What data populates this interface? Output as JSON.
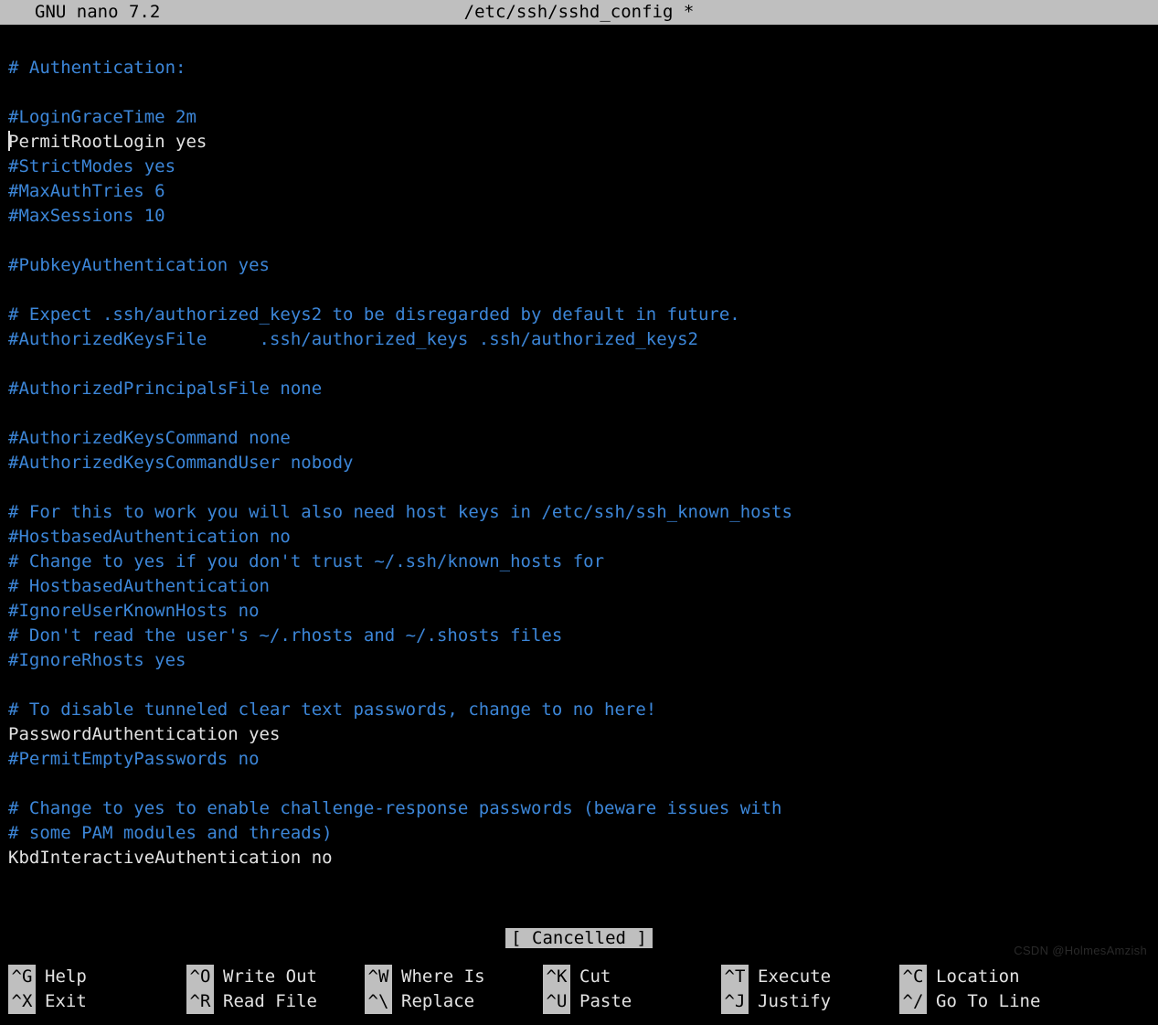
{
  "titlebar": {
    "app": "GNU nano 7.2",
    "filename": "/etc/ssh/sshd_config *"
  },
  "lines": [
    {
      "cls": "blank",
      "text": ""
    },
    {
      "cls": "comment",
      "text": "# Authentication:"
    },
    {
      "cls": "blank",
      "text": ""
    },
    {
      "cls": "comment",
      "text": "#LoginGraceTime 2m"
    },
    {
      "cls": "plain",
      "text": "PermitRootLogin yes",
      "cursor": true
    },
    {
      "cls": "comment",
      "text": "#StrictModes yes"
    },
    {
      "cls": "comment",
      "text": "#MaxAuthTries 6"
    },
    {
      "cls": "comment",
      "text": "#MaxSessions 10"
    },
    {
      "cls": "blank",
      "text": ""
    },
    {
      "cls": "comment",
      "text": "#PubkeyAuthentication yes"
    },
    {
      "cls": "blank",
      "text": ""
    },
    {
      "cls": "comment",
      "text": "# Expect .ssh/authorized_keys2 to be disregarded by default in future."
    },
    {
      "cls": "comment",
      "text": "#AuthorizedKeysFile     .ssh/authorized_keys .ssh/authorized_keys2"
    },
    {
      "cls": "blank",
      "text": ""
    },
    {
      "cls": "comment",
      "text": "#AuthorizedPrincipalsFile none"
    },
    {
      "cls": "blank",
      "text": ""
    },
    {
      "cls": "comment",
      "text": "#AuthorizedKeysCommand none"
    },
    {
      "cls": "comment",
      "text": "#AuthorizedKeysCommandUser nobody"
    },
    {
      "cls": "blank",
      "text": ""
    },
    {
      "cls": "comment",
      "text": "# For this to work you will also need host keys in /etc/ssh/ssh_known_hosts"
    },
    {
      "cls": "comment",
      "text": "#HostbasedAuthentication no"
    },
    {
      "cls": "comment",
      "text": "# Change to yes if you don't trust ~/.ssh/known_hosts for"
    },
    {
      "cls": "comment",
      "text": "# HostbasedAuthentication"
    },
    {
      "cls": "comment",
      "text": "#IgnoreUserKnownHosts no"
    },
    {
      "cls": "comment",
      "text": "# Don't read the user's ~/.rhosts and ~/.shosts files"
    },
    {
      "cls": "comment",
      "text": "#IgnoreRhosts yes"
    },
    {
      "cls": "blank",
      "text": ""
    },
    {
      "cls": "comment",
      "text": "# To disable tunneled clear text passwords, change to no here!"
    },
    {
      "cls": "plain",
      "text": "PasswordAuthentication yes"
    },
    {
      "cls": "comment",
      "text": "#PermitEmptyPasswords no"
    },
    {
      "cls": "blank",
      "text": ""
    },
    {
      "cls": "comment",
      "text": "# Change to yes to enable challenge-response passwords (beware issues with"
    },
    {
      "cls": "comment",
      "text": "# some PAM modules and threads)"
    },
    {
      "cls": "plain",
      "text": "KbdInteractiveAuthentication no"
    }
  ],
  "status": {
    "message": "[ Cancelled ]"
  },
  "shortcuts": {
    "row1": [
      {
        "key": "^G",
        "label": "Help"
      },
      {
        "key": "^O",
        "label": "Write Out"
      },
      {
        "key": "^W",
        "label": "Where Is"
      },
      {
        "key": "^K",
        "label": "Cut"
      },
      {
        "key": "^T",
        "label": "Execute"
      },
      {
        "key": "^C",
        "label": "Location"
      }
    ],
    "row2": [
      {
        "key": "^X",
        "label": "Exit"
      },
      {
        "key": "^R",
        "label": "Read File"
      },
      {
        "key": "^\\",
        "label": "Replace"
      },
      {
        "key": "^U",
        "label": "Paste"
      },
      {
        "key": "^J",
        "label": "Justify"
      },
      {
        "key": "^/",
        "label": "Go To Line"
      }
    ]
  },
  "watermark": "CSDN @HolmesAmzish"
}
